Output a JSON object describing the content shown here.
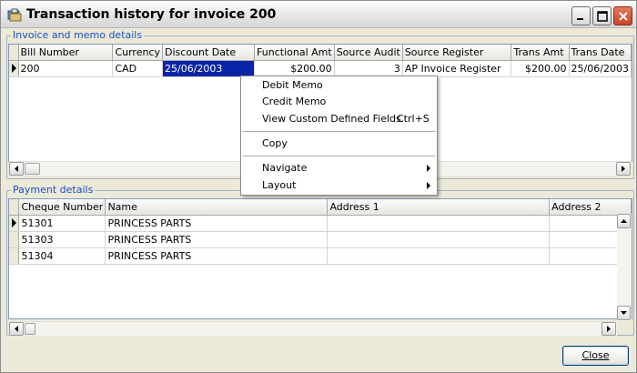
{
  "window": {
    "title": "Transaction history for invoice 200"
  },
  "invoice_group": {
    "legend": "Invoice and memo details",
    "columns": [
      "Bill Number",
      "Currency",
      "Discount Date",
      "Functional Amt",
      "Source Audit",
      "Source Register",
      "Trans Amt",
      "Trans Date"
    ],
    "rows": [
      [
        "200",
        "CAD",
        "25/06/2003",
        "$200.00",
        "3",
        "AP Invoice Register",
        "$200.00",
        "25/06/2003"
      ]
    ]
  },
  "payment_group": {
    "legend": "Payment details",
    "columns": [
      "Cheque Number",
      "Name",
      "Address 1",
      "Address 2"
    ],
    "rows": [
      [
        "51301",
        "PRINCESS PARTS",
        "",
        ""
      ],
      [
        "51303",
        "PRINCESS PARTS",
        "",
        ""
      ],
      [
        "51304",
        "PRINCESS PARTS",
        "",
        ""
      ]
    ]
  },
  "context_menu": {
    "items": [
      {
        "label": "Debit Memo",
        "shortcut": ""
      },
      {
        "label": "Credit Memo",
        "shortcut": ""
      },
      {
        "label": "View Custom Defined Fields",
        "shortcut": "Ctrl+S"
      },
      {
        "label": "Copy",
        "shortcut": ""
      },
      {
        "label": "Navigate",
        "shortcut": ""
      },
      {
        "label": "Layout",
        "shortcut": ""
      }
    ]
  },
  "footer": {
    "close_label": "Close"
  },
  "icons": {
    "app": "app-icon",
    "minimize": "minimize-icon",
    "maximize": "maximize-icon",
    "close": "close-icon"
  },
  "colors": {
    "selection": "#0a24a8",
    "legend_text": "#1750c6",
    "window_bg": "#ece9d8"
  }
}
